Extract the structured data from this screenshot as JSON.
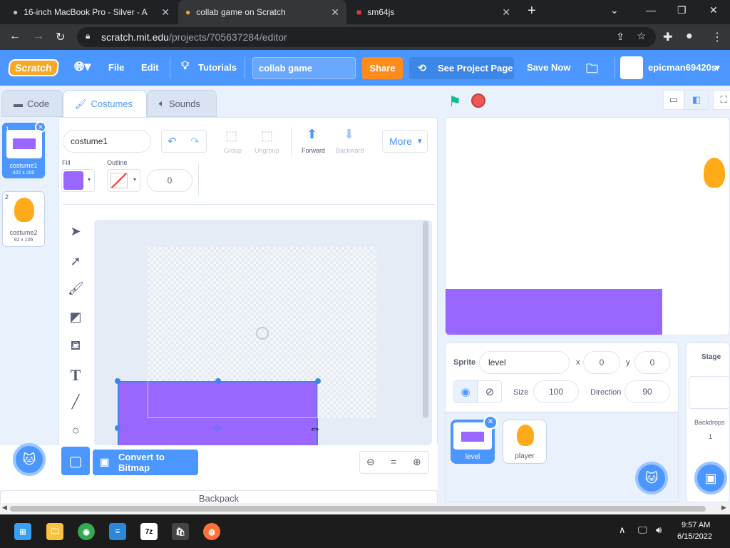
{
  "browser": {
    "tabs": [
      {
        "title": "16-inch MacBook Pro - Silver - A",
        "icon": "apple-icon"
      },
      {
        "title": "collab game on Scratch",
        "icon": "scratch-icon"
      },
      {
        "title": "sm64js",
        "icon": "sm64-icon"
      }
    ],
    "new_tab": "+",
    "url_host": "scratch.mit.edu",
    "url_path": "/projects/705637284/editor"
  },
  "menubar": {
    "logo": "Scratch",
    "file": "File",
    "edit": "Edit",
    "tutorials": "Tutorials",
    "project_title": "collab game",
    "share": "Share",
    "see_project": "See Project Page",
    "save_now": "Save Now",
    "username": "epicman69420s"
  },
  "editor_tabs": {
    "code": "Code",
    "costumes": "Costumes",
    "sounds": "Sounds"
  },
  "costumes": [
    {
      "index": "1",
      "name": "costume1",
      "size": "422 x 200"
    },
    {
      "index": "2",
      "name": "costume2",
      "size": "92 x 106"
    }
  ],
  "paint": {
    "costume_name": "costume1",
    "group": "Group",
    "ungroup": "Ungroup",
    "forward": "Forward",
    "backward": "Backward",
    "more": "More",
    "fill_label": "Fill",
    "outline_label": "Outline",
    "outline_width": "0",
    "convert": "Convert to Bitmap",
    "fill_color": "#9966ff"
  },
  "sprite_info": {
    "sprite_label": "Sprite",
    "sprite_name": "level",
    "x_label": "x",
    "x_value": "0",
    "y_label": "y",
    "y_value": "0",
    "size_label": "Size",
    "size_value": "100",
    "direction_label": "Direction",
    "direction_value": "90"
  },
  "sprites": [
    {
      "name": "level"
    },
    {
      "name": "player"
    }
  ],
  "stage_panel": {
    "title": "Stage",
    "backdrops_label": "Backdrops",
    "backdrops_count": "1"
  },
  "backpack": "Backpack",
  "taskbar": {
    "time": "9:57 AM",
    "date": "6/15/2022"
  }
}
